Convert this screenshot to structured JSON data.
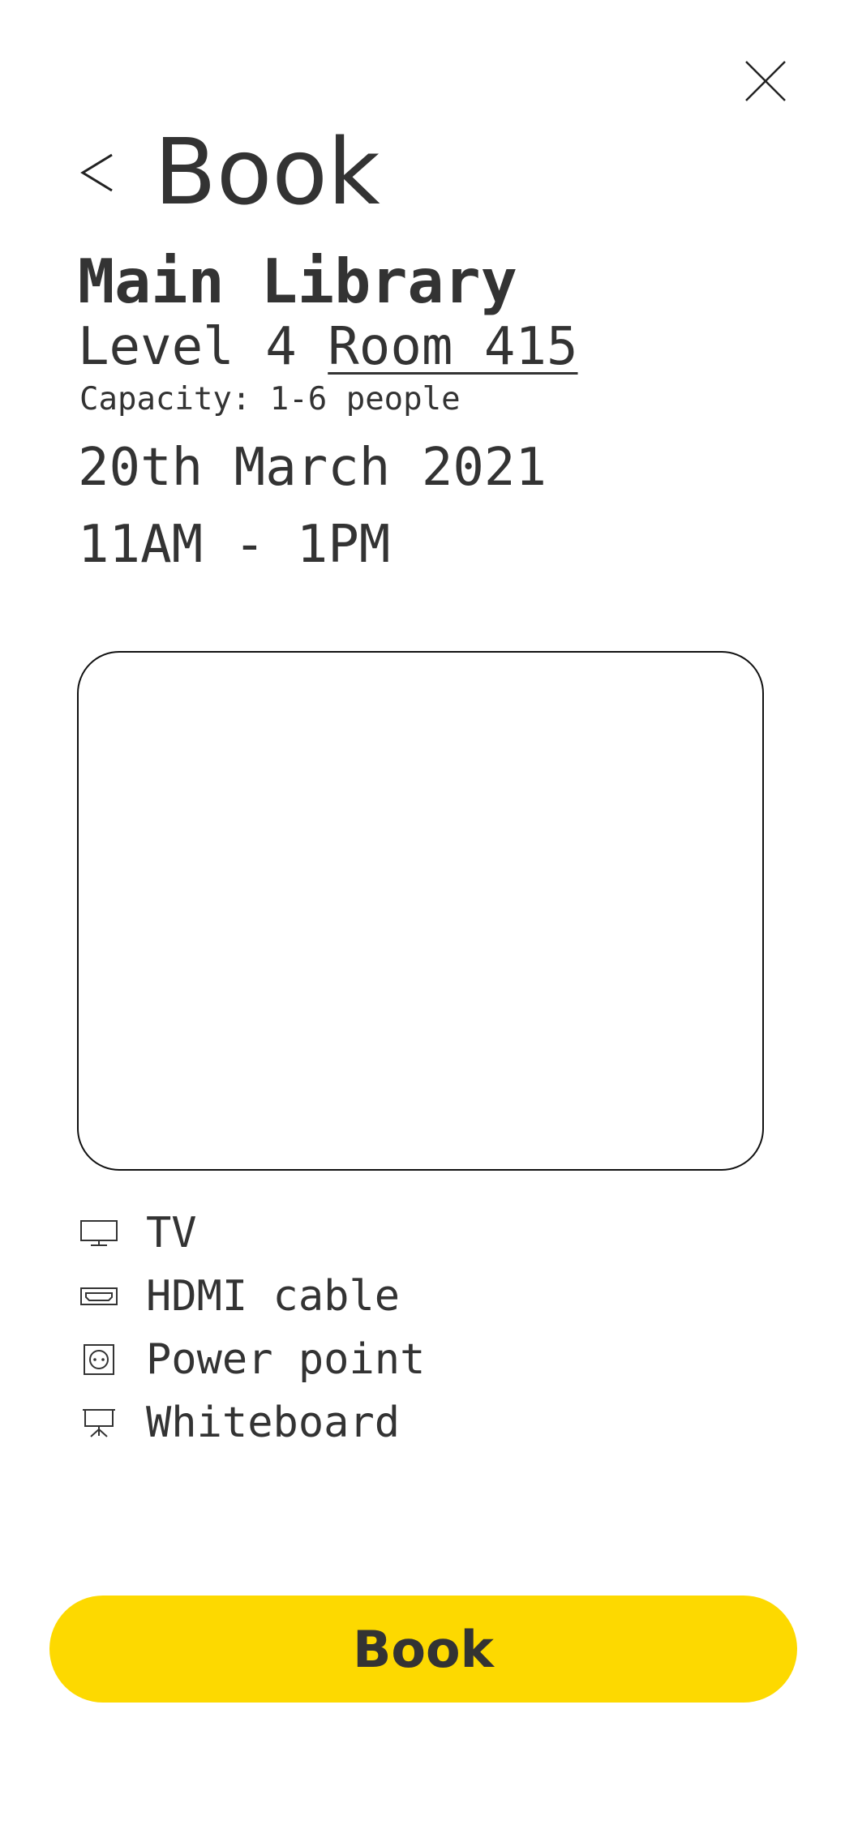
{
  "header": {
    "back_icon": "chevron-left-icon",
    "title": "Book",
    "close_icon": "close-icon"
  },
  "room": {
    "library": "Main Library",
    "level": "Level 4",
    "room_name": "Room 415",
    "capacity": "Capacity: 1-6 people"
  },
  "booking": {
    "date": "20th March 2021",
    "time": "11AM - 1PM"
  },
  "amenities": [
    {
      "icon": "tv-icon",
      "label": "TV"
    },
    {
      "icon": "hdmi-icon",
      "label": "HDMI cable"
    },
    {
      "icon": "power-outlet-icon",
      "label": "Power point"
    },
    {
      "icon": "whiteboard-icon",
      "label": "Whiteboard"
    }
  ],
  "actions": {
    "book_label": "Book"
  },
  "colors": {
    "accent": "#fdd900",
    "text": "#333333"
  }
}
